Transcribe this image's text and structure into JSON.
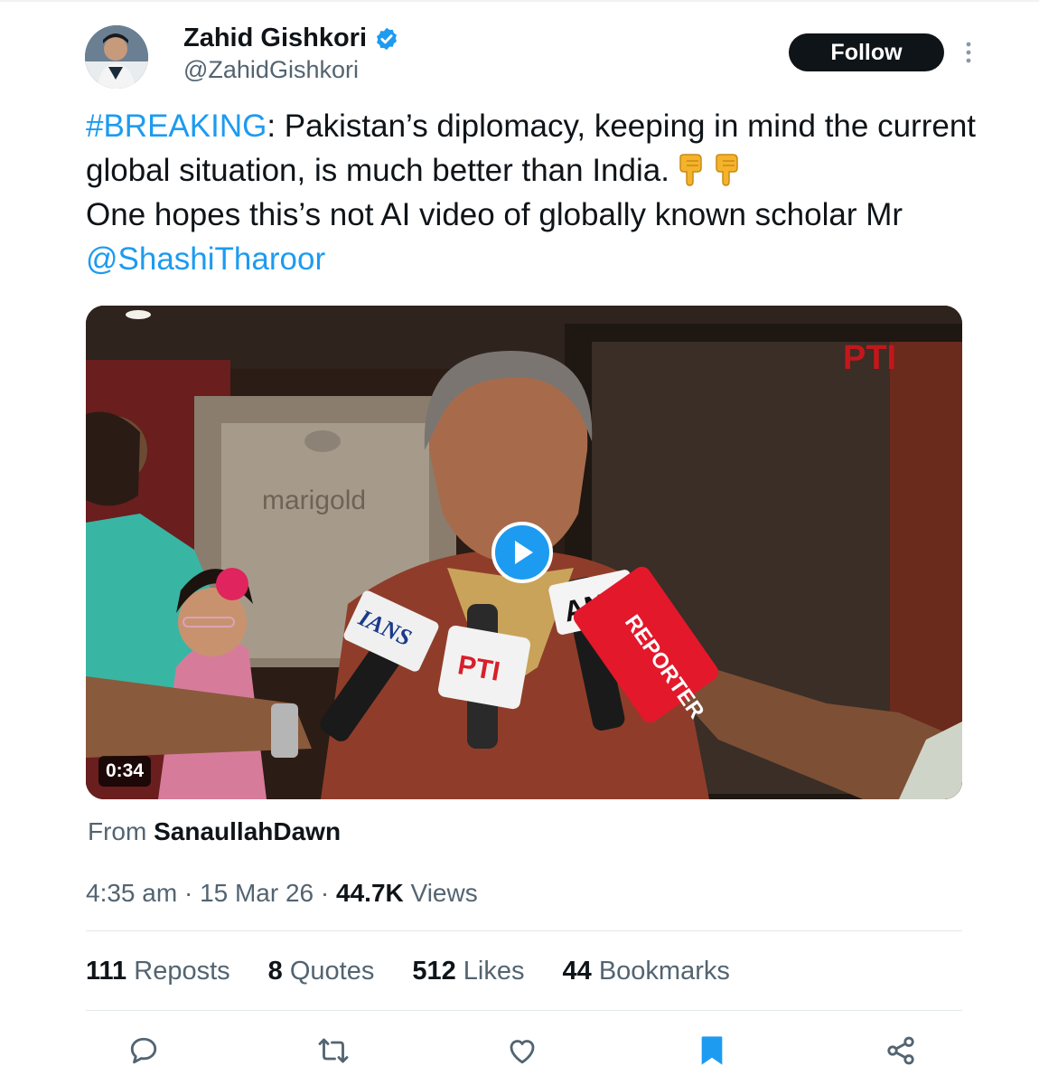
{
  "author": {
    "display_name": "Zahid Gishkori",
    "handle": "@ZahidGishkori",
    "verified": true
  },
  "header": {
    "follow_label": "Follow",
    "more_icon": "more-vertical-icon"
  },
  "tweet": {
    "hashtag": "#BREAKING",
    "text_part1": ": Pakistan’s diplomacy, keeping in mind the current global situation, is much better than India.",
    "emoji": "👇👇",
    "text_part2": "One hopes this’s not AI video of globally known scholar Mr",
    "mention": "@ShashiTharoor"
  },
  "media": {
    "duration": "0:34",
    "play_icon": "play-icon",
    "sign_text": "marigold",
    "watermark": "PTI",
    "mic_labels": [
      "IANS",
      "PTI",
      "ANI",
      "REPORTER"
    ]
  },
  "source": {
    "prefix": "From",
    "account": "SanaullahDawn"
  },
  "meta": {
    "time": "4:35 am",
    "date": "15 Mar 26",
    "separator": "·",
    "views_count": "44.7K",
    "views_label": "Views"
  },
  "stats": [
    {
      "count": "111",
      "label": "Reposts"
    },
    {
      "count": "8",
      "label": "Quotes"
    },
    {
      "count": "512",
      "label": "Likes"
    },
    {
      "count": "44",
      "label": "Bookmarks"
    }
  ],
  "actions": [
    "reply-icon",
    "repost-icon",
    "like-icon",
    "bookmark-icon",
    "share-icon"
  ],
  "colors": {
    "accent": "#1d9bf0",
    "text": "#0f1419",
    "muted": "#536471",
    "follow_bg": "#0f1419"
  }
}
